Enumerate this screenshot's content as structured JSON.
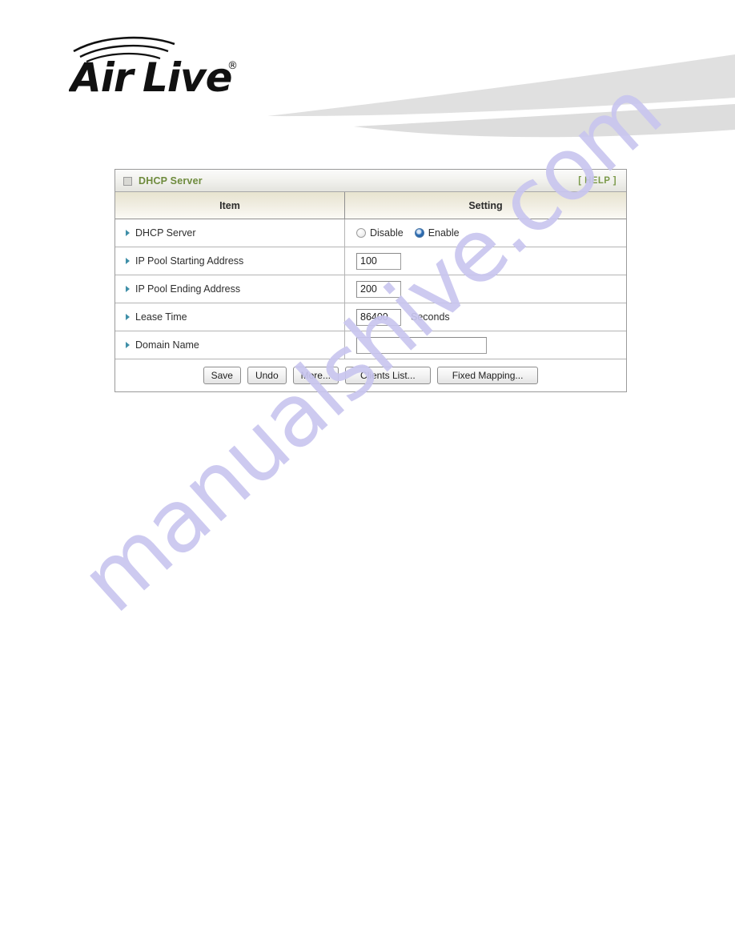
{
  "brand": {
    "name": "AirLive",
    "trademark": "®",
    "word_air": "Air",
    "word_live": "Live",
    "logo_icon": "wifi-arcs-icon",
    "swoosh_icon": "swoosh-graphic"
  },
  "watermark": {
    "text": "manualshive.com",
    "color": "#c9c6ef"
  },
  "panel": {
    "title": "DHCP Server",
    "title_color": "#6e8b3d",
    "title_icon": "window-square-icon",
    "help_label": "[ HELP ]",
    "help_color": "#7b9a4a",
    "columns": {
      "item": "Item",
      "setting": "Setting"
    },
    "rows": [
      {
        "label": "DHCP Server",
        "type": "radio",
        "options": [
          {
            "label": "Disable",
            "checked": false
          },
          {
            "label": "Enable",
            "checked": true
          }
        ]
      },
      {
        "label": "IP Pool Starting Address",
        "type": "text",
        "value": "100",
        "placeholder": "",
        "width": "small",
        "unit": ""
      },
      {
        "label": "IP Pool Ending Address",
        "type": "text",
        "value": "200",
        "placeholder": "",
        "width": "small",
        "unit": ""
      },
      {
        "label": "Lease Time",
        "type": "text",
        "value": "86400",
        "placeholder": "",
        "width": "small",
        "unit": "Seconds"
      },
      {
        "label": "Domain Name",
        "type": "text",
        "value": "",
        "placeholder": "",
        "width": "wide",
        "unit": ""
      }
    ],
    "buttons": [
      {
        "label": "Save",
        "wide": false
      },
      {
        "label": "Undo",
        "wide": false
      },
      {
        "label": "More...",
        "wide": false
      },
      {
        "label": "Clients List...",
        "wide": true
      },
      {
        "label": "Fixed Mapping...",
        "wide": true
      }
    ]
  }
}
